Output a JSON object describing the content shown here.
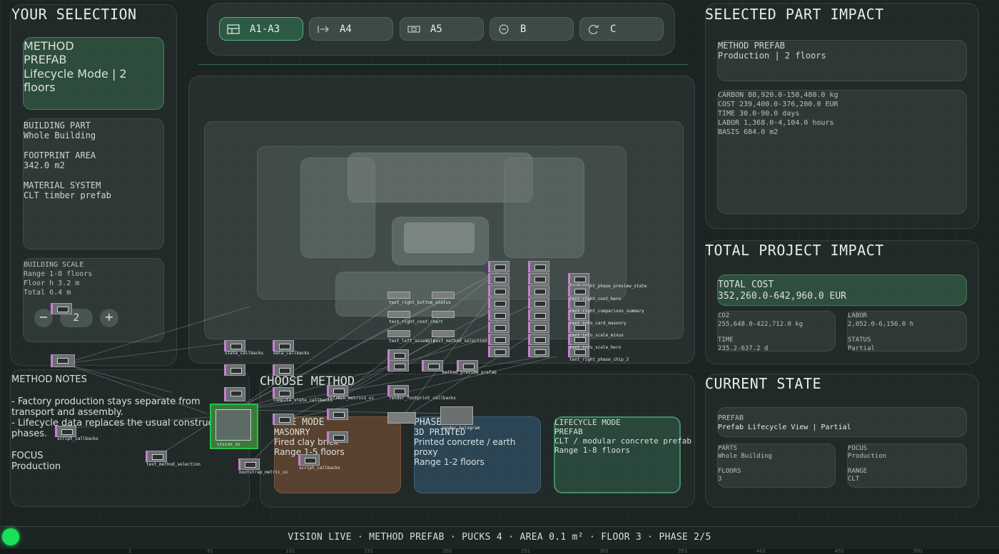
{
  "tabs": [
    {
      "label": "A1-A3",
      "icon": "table-icon",
      "active": true
    },
    {
      "label": "A4",
      "icon": "arrow-right-icon",
      "active": false
    },
    {
      "label": "A5",
      "icon": "recycle-box-icon",
      "active": false
    },
    {
      "label": "B",
      "icon": "circle-dot-icon",
      "active": false
    },
    {
      "label": "C",
      "icon": "refresh-icon",
      "active": false
    }
  ],
  "your_selection": {
    "title": "YOUR SELECTION",
    "method_line1": "METHOD",
    "method_line2": "PREFAB",
    "method_line3": "Lifecycle Mode | 2",
    "method_line4": "floors",
    "building_part_label": "BUILDING PART",
    "building_part_value": "Whole Building",
    "footprint_label": "FOOTPRINT AREA",
    "footprint_value": "342.0 m2",
    "material_label": "MATERIAL SYSTEM",
    "material_value": "CLT timber prefab",
    "scale_label": "BUILDING SCALE",
    "scale_range": "Range 1-8 floors",
    "scale_floor_h": "Floor h 3.2 m",
    "scale_total": "Total 6.4 m",
    "stepper_minus": "−",
    "stepper_value": "2",
    "stepper_plus": "+"
  },
  "method_notes": {
    "title": "METHOD NOTES",
    "line1": "- Factory production stays separate from",
    "line2": "transport and assembly.",
    "line3": "- Lifecycle data replaces the usual construct",
    "line4": "phases.",
    "focus_label": "FOCUS",
    "focus_value": "Production"
  },
  "choose_method": {
    "title": "CHOOSE METHOD",
    "cards": [
      {
        "title1": "BASE MODE",
        "title2": "MASONRY",
        "desc": "Fired clay brick",
        "range": "Range 1-5 floors",
        "color": "#6b4a32"
      },
      {
        "title1": "PHASE MODE",
        "title2": "3D PRINTED",
        "desc": "Printed concrete / earth",
        "desc2": "proxy",
        "range": "Range 1-2 floors",
        "color": "#2f4f63"
      },
      {
        "title1": "LIFECYCLE MODE",
        "title2": "PREFAB",
        "desc": "CLT / modular concrete prefab",
        "range": "Range 1-8 floors",
        "color": "#2c5240"
      }
    ]
  },
  "selected_part_impact": {
    "title": "SELECTED PART IMPACT",
    "method_line1": "METHOD PREFAB",
    "method_line2": "Production | 2 floors",
    "carbon": "CARBON 88,920.0-150,480.0 kg",
    "cost": "COST 239,400.0-376,200.0 EUR",
    "time": "TIME 30.0-90.0 days",
    "labor": "LABOR 1,368.0-4,104.0 hours",
    "basis": "BASIS 684.0 m2"
  },
  "total_project_impact": {
    "title": "TOTAL PROJECT IMPACT",
    "total_cost_label": "TOTAL COST",
    "total_cost_value": "352,260.0-642,960.0 EUR",
    "co2_label": "CO2",
    "co2_value": "255,648.0-422,712.0 kg",
    "labor_label": "LABOR",
    "labor_value": "2,052.0-6,156.0 h",
    "time_label": "TIME",
    "time_value": "235.2-637.2 d",
    "status_label": "STATUS",
    "status_value": "Partial"
  },
  "current_state": {
    "title": "CURRENT STATE",
    "mode_label": "PREFAB",
    "mode_value": "Prefab Lifecycle View | Partial",
    "parts_label": "PARTS",
    "parts_value": "Whole Building",
    "focus_label": "FOCUS",
    "focus_value": "Production",
    "floors_label": "FLOORS",
    "floors_value": "3",
    "range_label": "RANGE",
    "range_value": "CLT"
  },
  "status_bar": {
    "text": "VISION LIVE  ·  METHOD PREFAB  ·  PUCKS 4  ·  AREA 0.1 m²  ·  FLOOR 3  ·  PHASE 2/5",
    "indicator_color": "#19e05a"
  },
  "ruler_ticks": [
    "1",
    "51",
    "101",
    "151",
    "201",
    "251",
    "301",
    "351",
    "401",
    "451",
    "501"
  ],
  "graph_labels": {
    "n1": "vision_in",
    "n2": "state_callbacks",
    "n3": "data_callbacks",
    "n4": "text_method_selection",
    "n5": "script_callbacks",
    "n6": "compute_state_callbacks",
    "n7": "refresh_metrics_ui",
    "n8": "bootstrap_metric_ui",
    "n9": "text_right_phase_preview_state",
    "n10": "text_right_cost_hero",
    "n11": "text_right_comparison_summary",
    "n12": "text_info_card_masonry",
    "n13": "text_info_scale_minus",
    "n14": "text_info_scale_hero",
    "n15": "text_right_phase_chip_3",
    "n16": "text_right_bottom_status",
    "n17": "text_right_cost_chart",
    "n18": "text_left_assembly",
    "n19": "text_method_selection",
    "n20": "render_footprint_callbacks",
    "n21": "method_preview_prefab",
    "n22": "script_callbacks",
    "n23": "render_hologram"
  }
}
